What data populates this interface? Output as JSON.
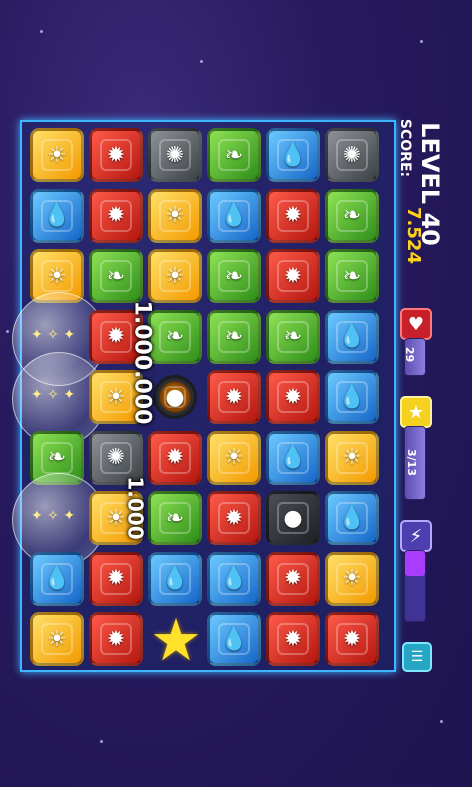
{
  "hud": {
    "level_label": "LEVEL 40",
    "score_label": "SCORE:",
    "score_value": "7.524",
    "hearts_value": "29",
    "stars_value": "3/13",
    "energy_level": 0.35,
    "menu_icon": "menu-icon",
    "heart_icon": "heart-icon",
    "star_icon": "star-icon",
    "energy_icon": "lightning-icon"
  },
  "popups": {
    "big_score": "1.000.000",
    "small_score": "1.000"
  },
  "board": {
    "columns": [
      "col1",
      "col2",
      "col3",
      "col4",
      "col5",
      "col6"
    ],
    "grid": [
      [
        "yellow",
        "red",
        "gray",
        "green",
        "blue",
        "gray"
      ],
      [
        "blue",
        "red",
        "yellow",
        "blue",
        "red",
        "green"
      ],
      [
        "yellow",
        "green",
        "yellow",
        "green",
        "red",
        "green"
      ],
      [
        "bubble",
        "red",
        "green",
        "green",
        "green",
        "blue"
      ],
      [
        "bubble",
        "yellow",
        "bomb",
        "red",
        "red",
        "blue"
      ],
      [
        "green",
        "gray",
        "red",
        "yellow",
        "blue",
        "yellow"
      ],
      [
        "bubble",
        "yellow",
        "green",
        "red",
        "dark",
        "blue"
      ],
      [
        "blue",
        "red",
        "blue",
        "blue",
        "red",
        "yellow"
      ],
      [
        "yellow",
        "red",
        "star",
        "blue",
        "red",
        "red"
      ]
    ],
    "symbols": {
      "yellow": "☀",
      "red": "✹",
      "blue": "💧",
      "green": "❧",
      "gray": "✺",
      "dark": "●",
      "bomb": "●"
    },
    "mascot_icon": "star-mascot-icon"
  }
}
